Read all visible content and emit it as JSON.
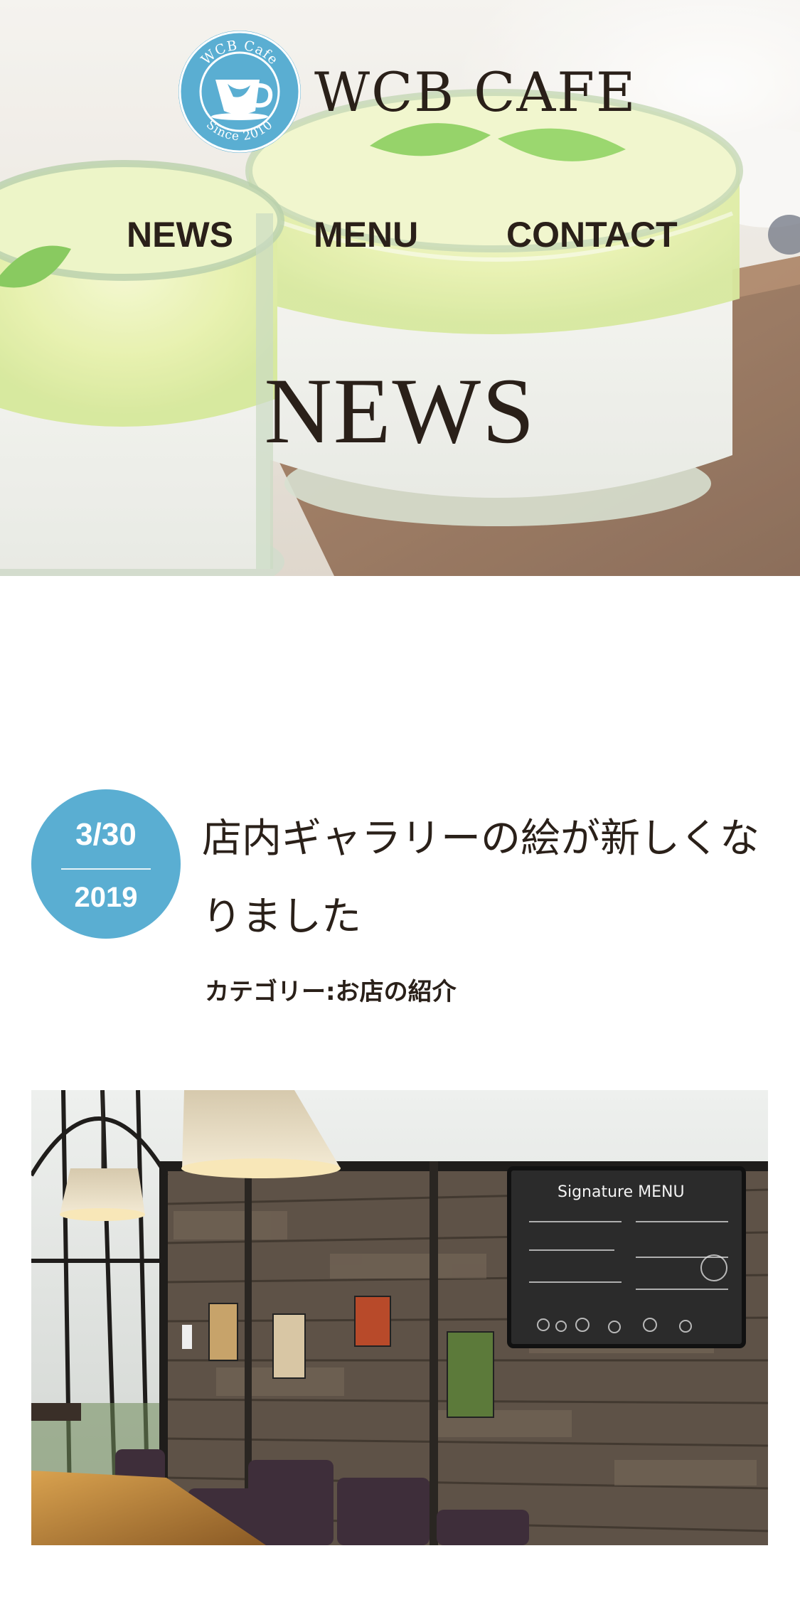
{
  "site": {
    "brand": "WCB CAFE",
    "logo": {
      "ring_top_text": "WCB Cafe",
      "ring_bottom_text": "Since 2010",
      "icon": "coffee-cup-icon"
    }
  },
  "nav": {
    "items": [
      {
        "label": "NEWS"
      },
      {
        "label": "MENU"
      },
      {
        "label": "CONTACT"
      }
    ]
  },
  "hero": {
    "title": "NEWS"
  },
  "article": {
    "date": {
      "month_day": "3/30",
      "year": "2019"
    },
    "title": "店内ギャラリーの絵が新しくなりました",
    "category": "カテゴリー:お店の紹介",
    "image": {
      "menu_board_title": "Signature MENU"
    }
  },
  "colors": {
    "accent": "#5aaed2",
    "text": "#2a2019",
    "background": "#ffffff"
  }
}
